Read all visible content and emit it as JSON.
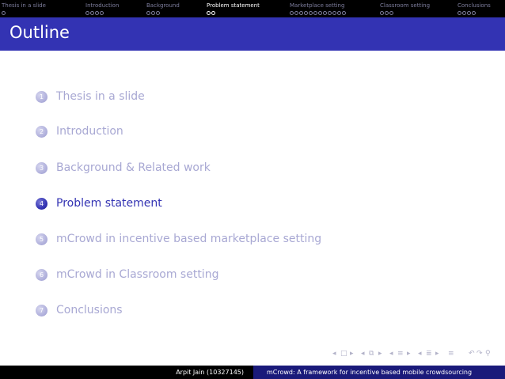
{
  "nav": {
    "sections": [
      {
        "title": "Thesis in a slide",
        "dots": 1,
        "active": false
      },
      {
        "title": "Introduction",
        "dots": 4,
        "active": false
      },
      {
        "title": "Background",
        "dots": 3,
        "active": false
      },
      {
        "title": "Problem statement",
        "dots": 2,
        "active": true
      },
      {
        "title": "Marketplace setting",
        "dots": 12,
        "active": false
      },
      {
        "title": "Classroom setting",
        "dots": 3,
        "active": false
      },
      {
        "title": "Conclusions",
        "dots": 4,
        "active": false
      }
    ]
  },
  "frame": {
    "title": "Outline"
  },
  "toc": {
    "current_index": 4,
    "items": [
      {
        "number": "1",
        "label": "Thesis in a slide"
      },
      {
        "number": "2",
        "label": "Introduction"
      },
      {
        "number": "3",
        "label": "Background & Related work"
      },
      {
        "number": "4",
        "label": "Problem statement"
      },
      {
        "number": "5",
        "label": "mCrowd in incentive based marketplace setting"
      },
      {
        "number": "6",
        "label": "mCrowd in Classroom setting"
      },
      {
        "number": "7",
        "label": "Conclusions"
      }
    ]
  },
  "footer": {
    "author": "Arpit Jain (10327145)",
    "title": "mCrowd: A framework for incentive based mobile crowdsourcing"
  },
  "colors": {
    "accent": "#3333b3",
    "inactive": "#a8a8d3",
    "navbar": "#000000",
    "footer_right": "#1a1a7a"
  }
}
